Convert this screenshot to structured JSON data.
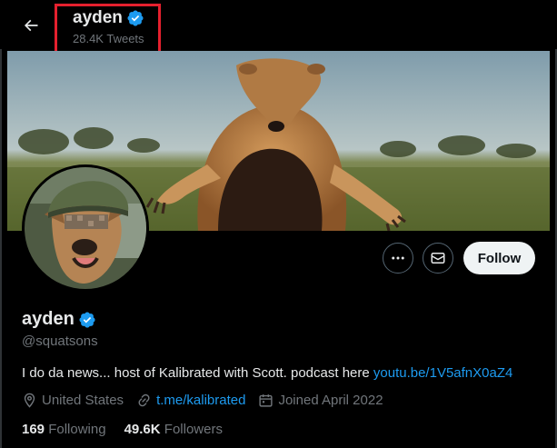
{
  "header": {
    "title": "ayden",
    "tweet_count": "28.4K Tweets"
  },
  "actions": {
    "more_icon": "more-icon",
    "message_icon": "envelope-icon",
    "follow_label": "Follow"
  },
  "profile": {
    "name": "ayden",
    "handle": "@squatsons",
    "bio_text": "I do da news... host of Kalibrated with Scott. podcast here ",
    "bio_link": "youtu.be/1V5afnX0aZ4",
    "location": "United States",
    "website": "t.me/kalibrated",
    "joined": "Joined April 2022",
    "following_count": "169",
    "following_label": "Following",
    "followers_count": "49.6K",
    "followers_label": "Followers"
  },
  "colors": {
    "background": "#000000",
    "accent": "#1d9bf0",
    "muted": "#71767b",
    "highlight_box": "#e5202e"
  }
}
